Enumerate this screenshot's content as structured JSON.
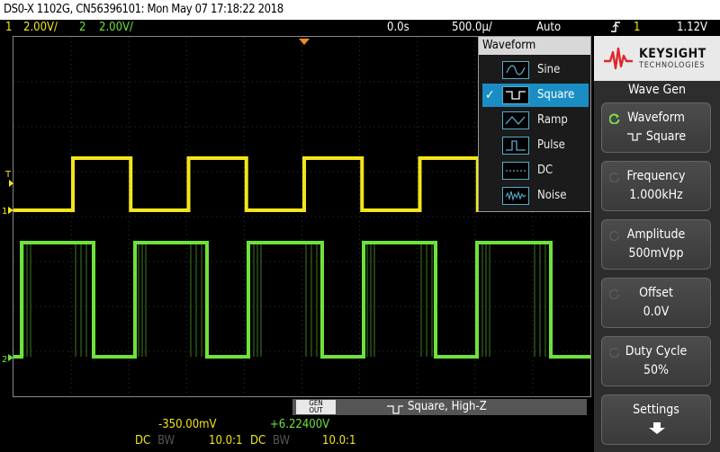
{
  "title_bar": {
    "text": "DS0-X 1102G, CN56396101: Mon May 07 17:18:22 2018"
  },
  "status": {
    "ch1_num": "1",
    "ch1_scale": "2.00V/",
    "ch2_num": "2",
    "ch2_scale": "2.00V/",
    "time_offset": "0.0s",
    "time_scale": "500.0µ/",
    "trigger_mode": "Auto",
    "trigger_icon": "trigger-edge-icon",
    "trigger_channel": "1",
    "trigger_level": "1.12V"
  },
  "colors": {
    "ch1": "#f2e61a",
    "ch2": "#6ee23a",
    "accent": "#1a8ec4",
    "brand_red": "#e0262b"
  },
  "markers": {
    "trigger_marker": "T",
    "ch1_marker": "1",
    "ch2_marker": "2"
  },
  "menu": {
    "title": "Waveform",
    "items": [
      {
        "label": "Sine",
        "icon": "sine-wave-icon",
        "selected": false
      },
      {
        "label": "Square",
        "icon": "square-wave-icon",
        "selected": true
      },
      {
        "label": "Ramp",
        "icon": "ramp-wave-icon",
        "selected": false
      },
      {
        "label": "Pulse",
        "icon": "pulse-wave-icon",
        "selected": false
      },
      {
        "label": "DC",
        "icon": "dc-icon",
        "selected": false
      },
      {
        "label": "Noise",
        "icon": "noise-icon",
        "selected": false
      }
    ],
    "check": "✓"
  },
  "gen_bar": {
    "badge_line1": "GEN",
    "badge_line2": "OUT",
    "label": "Square, High-Z"
  },
  "readouts": {
    "ch1_offset": "-350.00mV",
    "ch2_offset": "+6.22400V",
    "ch1_coupling": "DC",
    "ch1_bw": "BW",
    "ch1_probe": "10.0:1",
    "ch2_coupling": "DC",
    "ch2_bw": "BW",
    "ch2_probe": "10.0:1"
  },
  "panel": {
    "brand": "KEYSIGHT",
    "brand_sub": "TECHNOLOGIES",
    "title": "Wave Gen",
    "softkeys": [
      {
        "line1": "Waveform",
        "line2": "Square",
        "active_knob": true
      },
      {
        "line1": "Frequency",
        "line2": "1.000kHz",
        "active_knob": false
      },
      {
        "line1": "Amplitude",
        "line2": "500mVpp",
        "active_knob": false
      },
      {
        "line1": "Offset",
        "line2": "0.0V",
        "active_knob": false
      },
      {
        "line1": "Duty Cycle",
        "line2": "50%",
        "active_knob": false
      },
      {
        "line1": "Settings",
        "line2": "",
        "active_knob": false
      }
    ]
  }
}
